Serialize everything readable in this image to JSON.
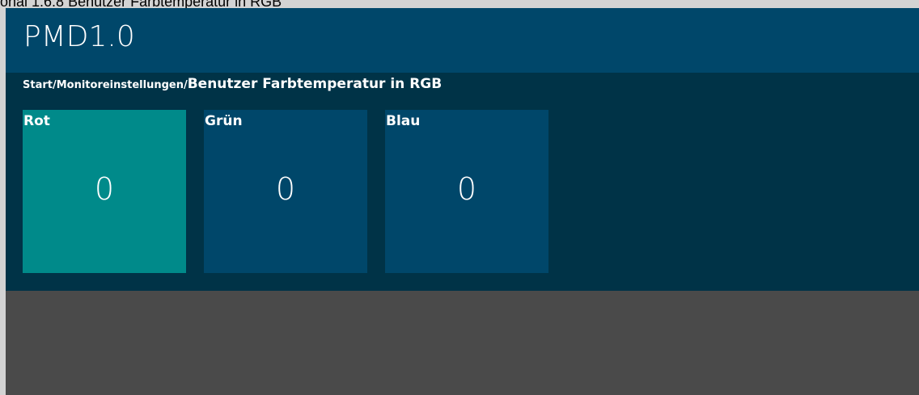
{
  "document_title": "onal 1.6.8 Benutzer Farbtemperatur in RGB",
  "app": {
    "title": "PMD1.0"
  },
  "breadcrumb": {
    "path": "Start/Monitoreinstellungen/",
    "current": "Benutzer Farbtemperatur in RGB"
  },
  "tiles": [
    {
      "label": "Rot",
      "value": "0",
      "color": "#008a8a",
      "active": true
    },
    {
      "label": "Grün",
      "value": "0",
      "color": "#00476a",
      "active": false
    },
    {
      "label": "Blau",
      "value": "0",
      "color": "#00476a",
      "active": false
    }
  ],
  "colors": {
    "header": "#00476a",
    "content": "#003347",
    "background": "#4a4a4a"
  }
}
